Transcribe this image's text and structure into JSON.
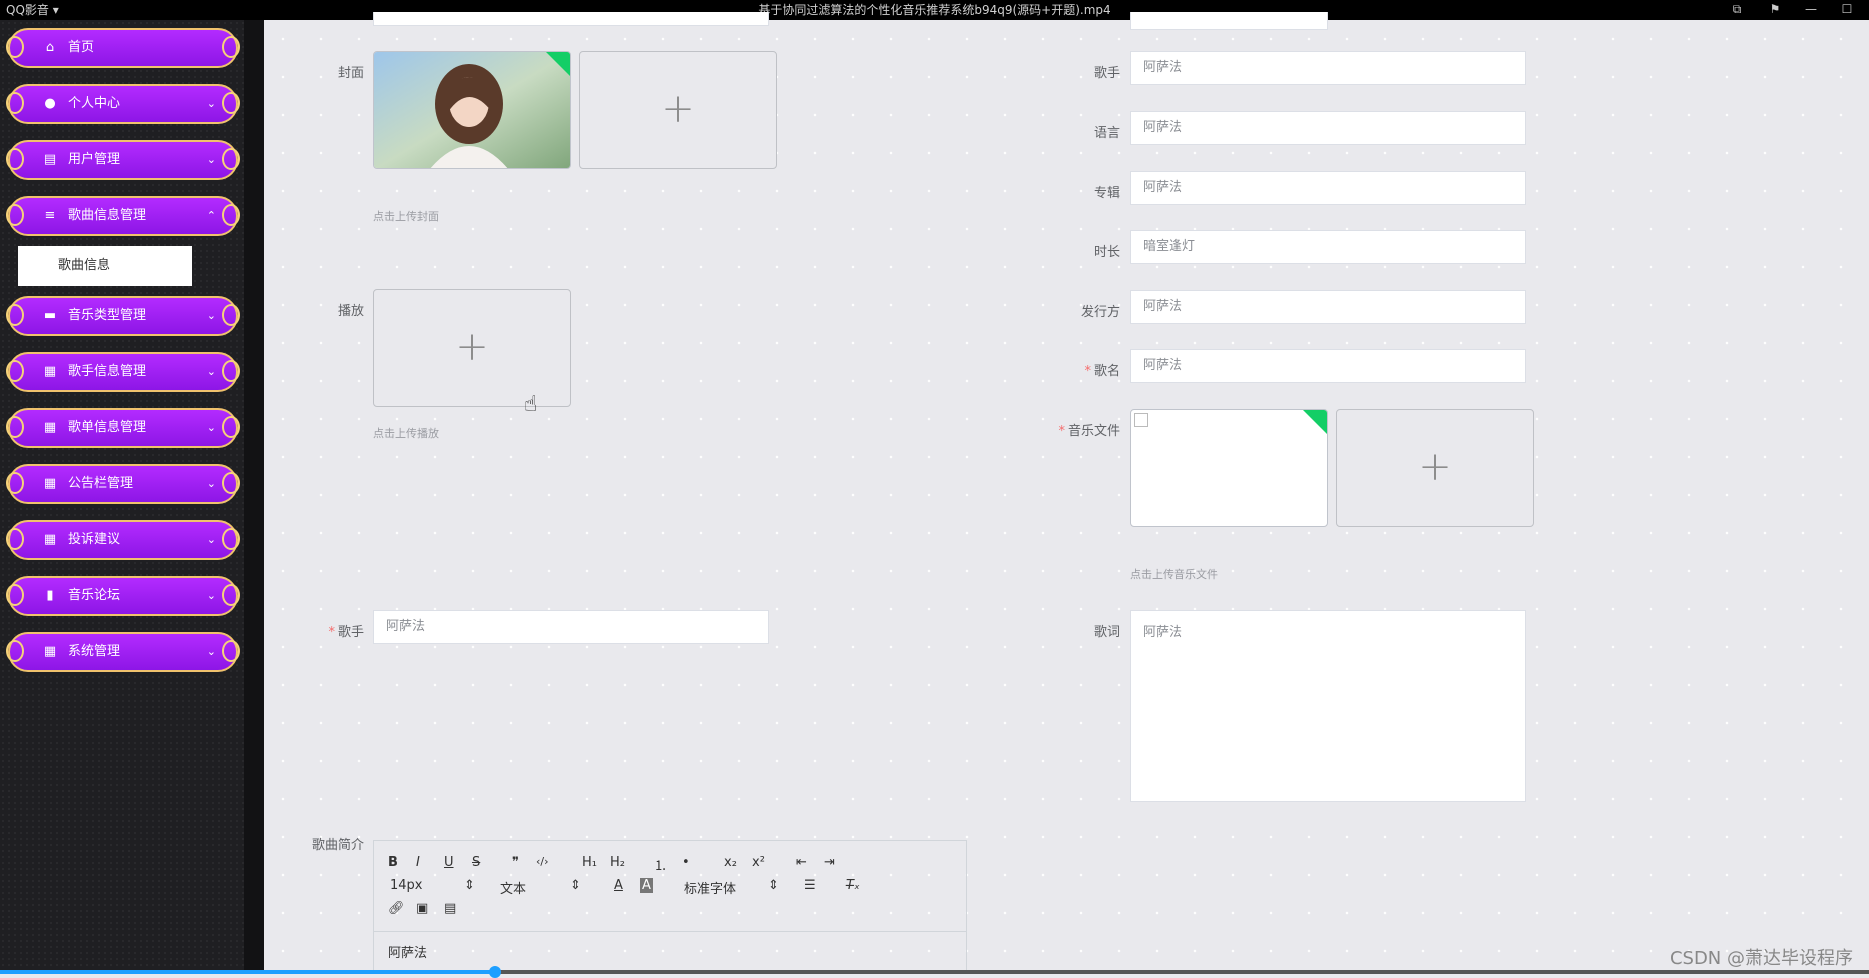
{
  "player": {
    "app_name": "QQ影音 ▾",
    "title": "基于协同过滤算法的个性化音乐推荐系统b94q9(源码+开题).mp4"
  },
  "sidebar": {
    "items": [
      {
        "icon": "⌂",
        "label": "首页",
        "arrow": ""
      },
      {
        "icon": "●",
        "label": "个人中心",
        "arrow": "⌄"
      },
      {
        "icon": "▤",
        "label": "用户管理",
        "arrow": "⌄"
      },
      {
        "icon": "≡",
        "label": "歌曲信息管理",
        "arrow": "⌃"
      },
      {
        "icon": "▬",
        "label": "音乐类型管理",
        "arrow": "⌄"
      },
      {
        "icon": "▦",
        "label": "歌手信息管理",
        "arrow": "⌄"
      },
      {
        "icon": "▦",
        "label": "歌单信息管理",
        "arrow": "⌄"
      },
      {
        "icon": "▦",
        "label": "公告栏管理",
        "arrow": "⌄"
      },
      {
        "icon": "▦",
        "label": "投诉建议",
        "arrow": "⌄"
      },
      {
        "icon": "▮",
        "label": "音乐论坛",
        "arrow": "⌄"
      },
      {
        "icon": "▦",
        "label": "系统管理",
        "arrow": "⌄"
      }
    ],
    "submenu_label": "歌曲信息"
  },
  "form": {
    "cover_label": "封面",
    "cover_hint": "点击上传封面",
    "play_label": "播放",
    "play_hint": "点击上传播放",
    "singer_left_label": "歌手",
    "singer_left_placeholder": "阿萨法",
    "intro_label": "歌曲简介",
    "singer_label": "歌手",
    "singer_value": "阿萨法",
    "language_label": "语言",
    "language_value": "阿萨法",
    "album_label": "专辑",
    "album_value": "阿萨法",
    "duration_label": "时长",
    "duration_value": "暗室逢灯",
    "publisher_label": "发行方",
    "publisher_value": "阿萨法",
    "song_name_label": "歌名",
    "song_name_value": "阿萨法",
    "music_file_label": "音乐文件",
    "music_file_hint": "点击上传音乐文件",
    "lyrics_label": "歌词",
    "lyrics_value": "阿萨法"
  },
  "editor": {
    "row1": [
      "B",
      "I",
      "U",
      "S",
      "❞",
      "‹/›",
      "H₁",
      "H₂",
      "⒈",
      "•",
      "x₂",
      "x²",
      "⇤",
      "⇥"
    ],
    "font_size": "14px",
    "text_style": "文本",
    "font_family": "标准字体",
    "content": "阿萨法"
  },
  "watermark": "CSDN @萧达毕设程序",
  "video_progress": 0.265,
  "colors": {
    "menu_purple": "#a020f0",
    "menu_border": "#f0c26d",
    "accent_green": "#13ce66",
    "progress_blue": "#1e9fff"
  }
}
